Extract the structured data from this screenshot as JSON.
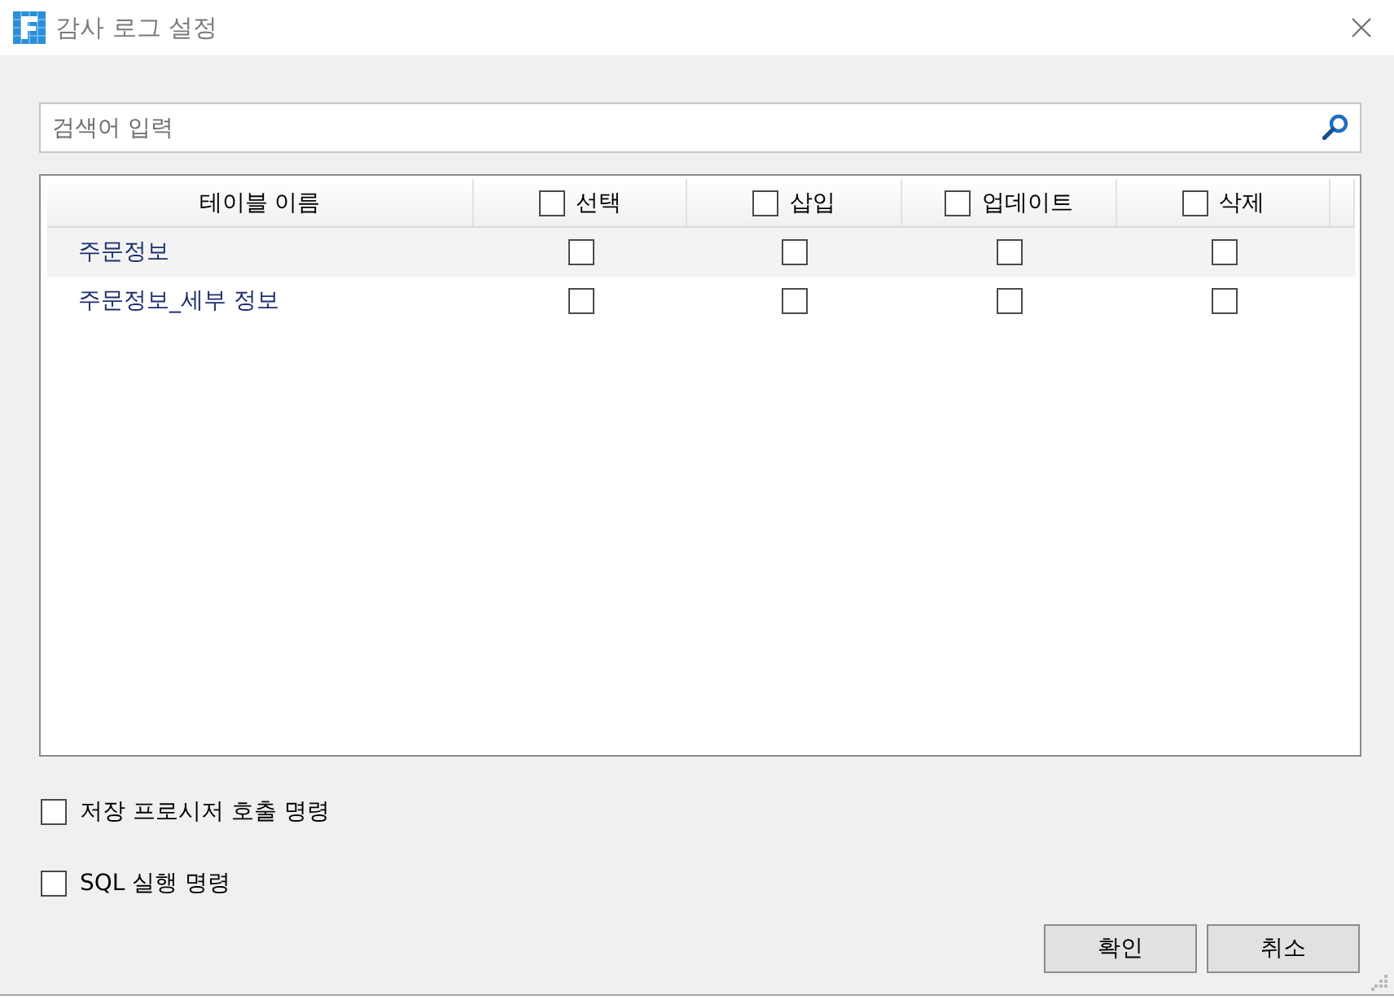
{
  "window": {
    "title": "감사 로그 설정"
  },
  "search": {
    "placeholder": "검색어 입력"
  },
  "table": {
    "columns": [
      {
        "kind": "text",
        "label": "테이블 이름"
      },
      {
        "kind": "checkbox",
        "label": "선택",
        "checked": false
      },
      {
        "kind": "checkbox",
        "label": "삽입",
        "checked": false
      },
      {
        "kind": "checkbox",
        "label": "업데이트",
        "checked": false
      },
      {
        "kind": "checkbox",
        "label": "삭제",
        "checked": false
      }
    ],
    "rows": [
      {
        "name": "주문정보",
        "checks": [
          {
            "checked": false
          },
          {
            "checked": false
          },
          {
            "checked": false
          },
          {
            "checked": false
          }
        ]
      },
      {
        "name": "주문정보_세부 정보",
        "checks": [
          {
            "checked": false
          },
          {
            "checked": false
          },
          {
            "checked": false
          },
          {
            "checked": false
          }
        ]
      }
    ]
  },
  "options": [
    {
      "label": "저장 프로시저 호출 명령",
      "checked": false
    },
    {
      "label": "SQL 실행 명령",
      "checked": false
    }
  ],
  "buttons": [
    {
      "label": "확인"
    },
    {
      "label": "취소"
    }
  ]
}
